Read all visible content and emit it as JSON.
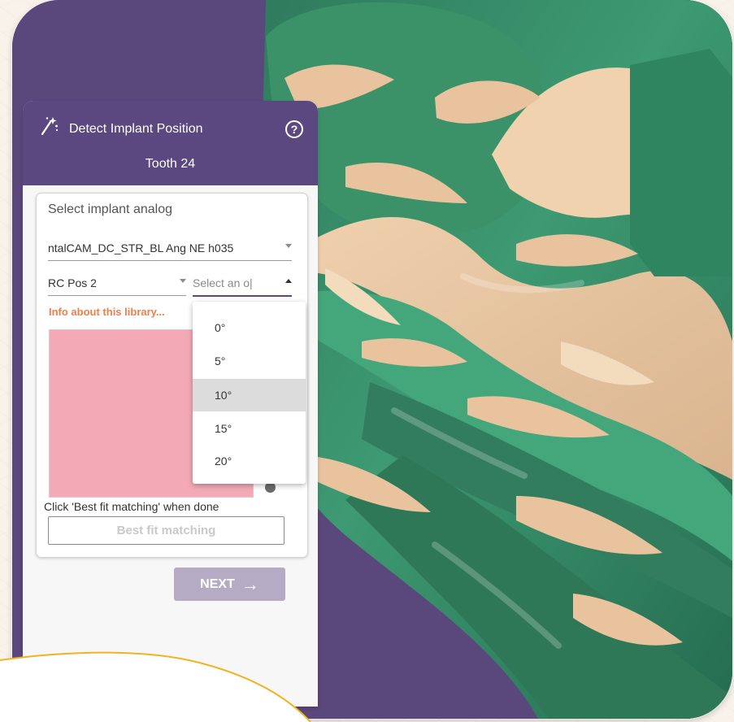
{
  "panel": {
    "title": "Detect Implant Position",
    "subtitle": "Tooth 24",
    "section_title": "Select implant analog",
    "analog_select_value": "ntalCAM_DC_STR_BL  Ang NE h035",
    "position_select_value": "RC Pos 2",
    "angle_select_placeholder": "Select an o|",
    "info_link": "Info about this library...",
    "hint": "Click 'Best fit matching' when done",
    "best_fit_button": "Best fit matching",
    "next_button": "NEXT"
  },
  "dropdown": {
    "options": [
      "0°",
      "5°",
      "10°",
      "15°",
      "20°"
    ],
    "highlighted_index": 2
  },
  "icons": {
    "wand": "magic-wand-icon",
    "help": "help-icon",
    "caret_down": "chevron-down-icon",
    "caret_up": "chevron-up-icon",
    "next": "arrow-right-icon"
  },
  "colors": {
    "header_purple": "#5c4880",
    "background_purple": "#5a477c",
    "accent_orange": "#ee7f4a",
    "preview_pink": "#f4aab6",
    "model_green": "#3f8f6b",
    "model_tan": "#e8c39e"
  }
}
